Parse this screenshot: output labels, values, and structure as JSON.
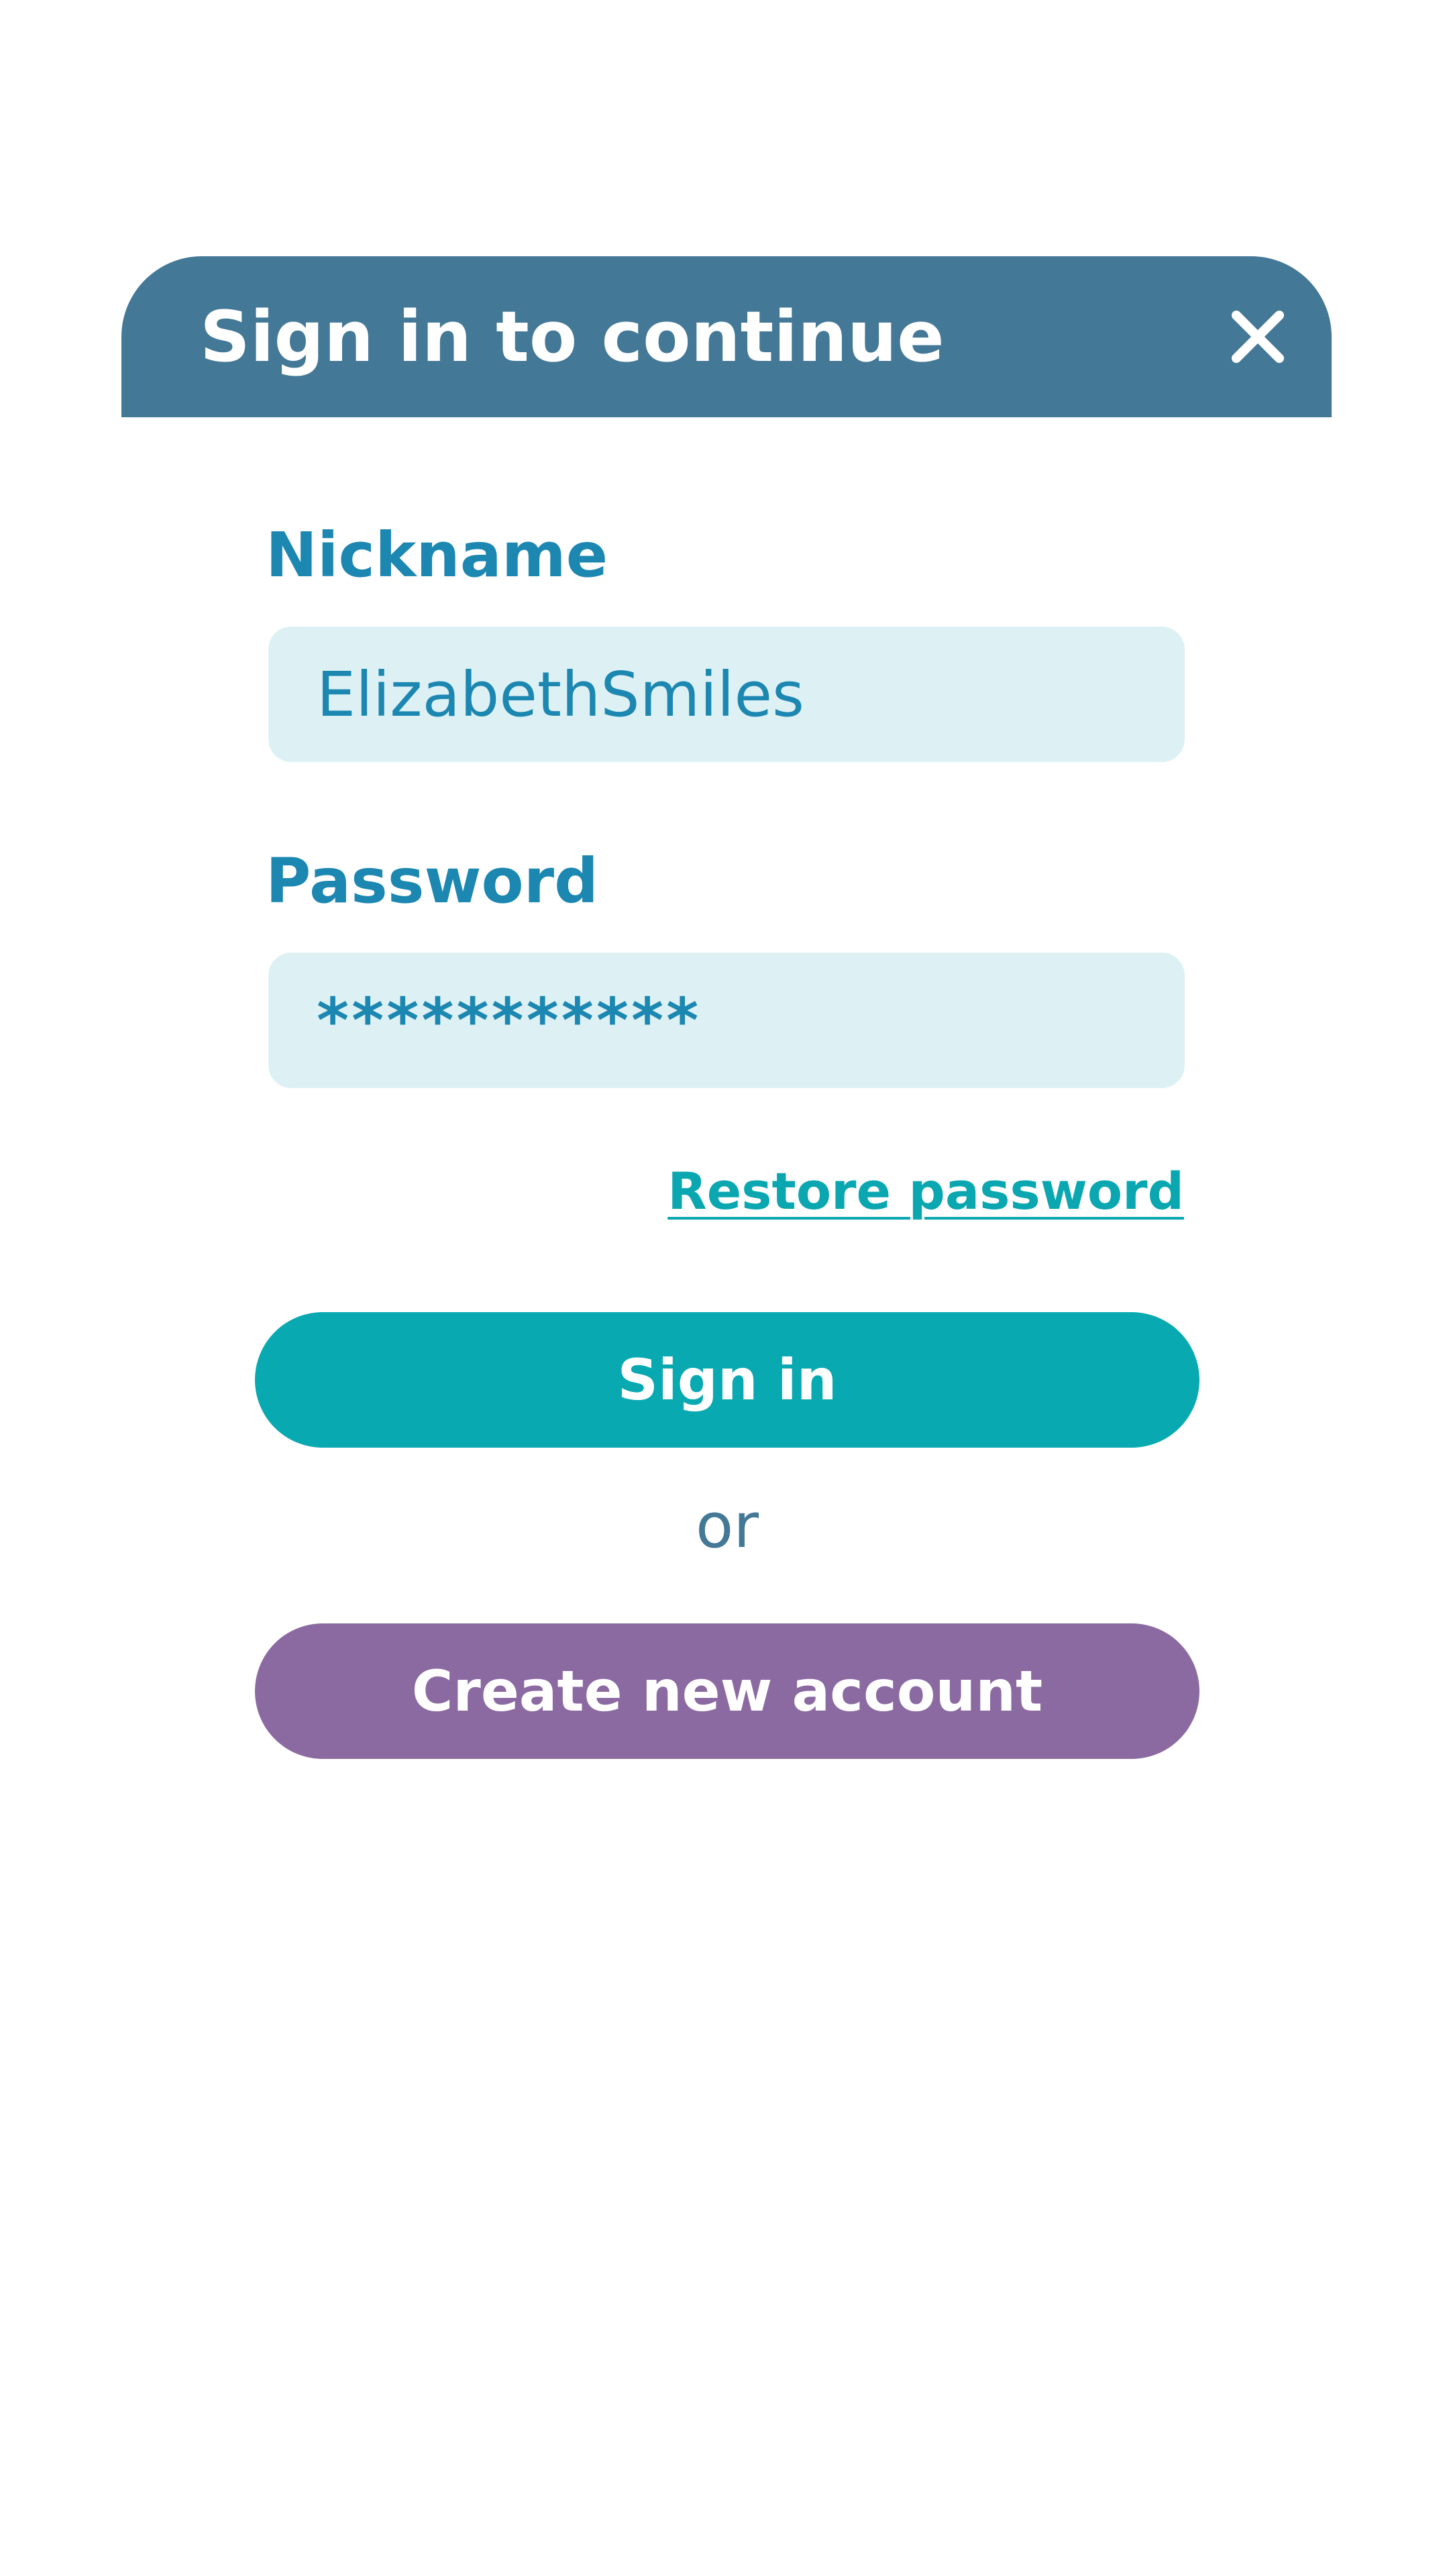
{
  "dialog": {
    "title": "Sign in to continue",
    "close_icon": "close-icon",
    "header_color": "#437896"
  },
  "form": {
    "nickname_label": "Nickname",
    "nickname_value": "ElizabethSmiles",
    "password_label": "Password",
    "password_value": "***********",
    "restore_link": "Restore password",
    "signin_label": "Sign in",
    "or_text": "or",
    "create_label": "Create new account"
  },
  "colors": {
    "label": "#1c87b1",
    "input_bg": "#ddf1f5",
    "accent": "#09a9b2",
    "secondary": "#8b6aa2"
  }
}
